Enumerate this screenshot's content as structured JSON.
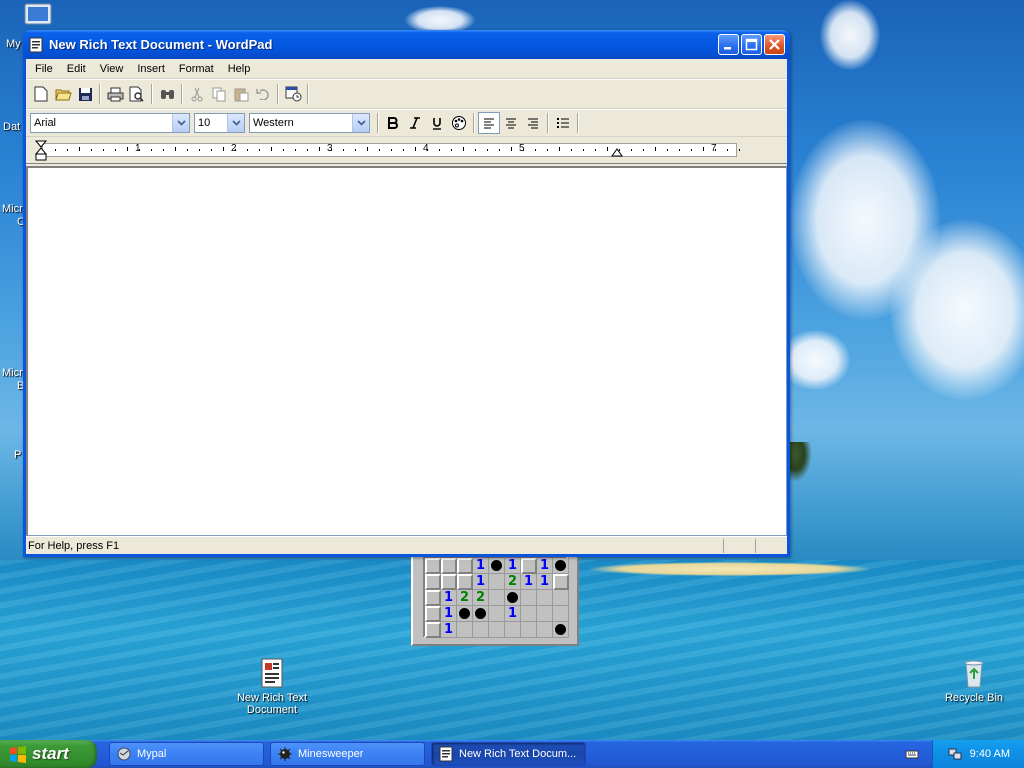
{
  "window": {
    "title": "New Rich Text Document - WordPad",
    "menu": [
      "File",
      "Edit",
      "View",
      "Insert",
      "Format",
      "Help"
    ],
    "format": {
      "font": "Arial",
      "size": "10",
      "script": "Western"
    },
    "ruler_numbers": [
      "1",
      "2",
      "3",
      "4",
      "5",
      "7"
    ],
    "status": "For Help, press F1"
  },
  "desktop": {
    "left_labels": [
      "My",
      "Dat",
      "Micro",
      "C",
      "Micro",
      "B",
      "P"
    ],
    "icons": [
      {
        "name": "New Rich Text Document",
        "label": "New Rich Text Document"
      },
      {
        "name": "Recycle Bin",
        "label": "Recycle Bin"
      }
    ]
  },
  "minesweeper": {
    "rows": [
      [
        "c",
        "c",
        "c",
        "1",
        "m",
        "1",
        "c",
        "1",
        "m"
      ],
      [
        "c",
        "c",
        "c",
        "1",
        "e",
        "2",
        "1",
        "1",
        "c"
      ],
      [
        "c",
        "1",
        "2",
        "2",
        "e",
        "m",
        "e",
        "e",
        "e"
      ],
      [
        "c",
        "1",
        "m",
        "m",
        "e",
        "1",
        "e",
        "e",
        "e"
      ],
      [
        "c",
        "1",
        "e",
        "e",
        "e",
        "e",
        "e",
        "e",
        "m"
      ]
    ]
  },
  "taskbar": {
    "start_label": "start",
    "tasks": [
      {
        "label": "Mypal",
        "active": false
      },
      {
        "label": "Minesweeper",
        "active": false
      },
      {
        "label": "New Rich Text Docum...",
        "active": true
      }
    ],
    "clock": "9:40 AM"
  }
}
